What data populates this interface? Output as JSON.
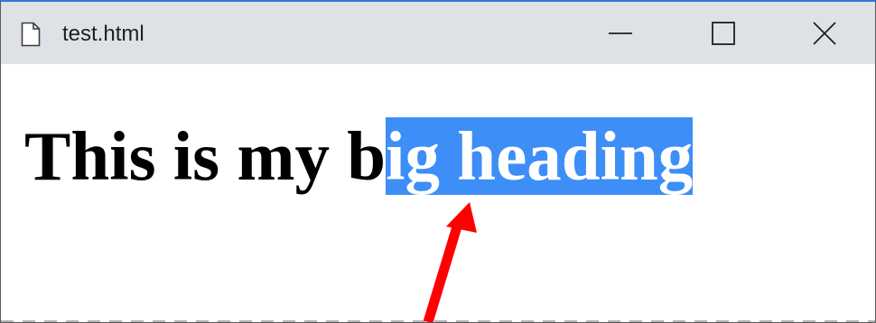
{
  "window": {
    "title": "test.html",
    "icon": "document-icon",
    "controls": {
      "minimize_icon": "minimize-icon",
      "maximize_icon": "maximize-icon",
      "close_icon": "close-icon"
    }
  },
  "content": {
    "heading_unselected": "This is my b",
    "heading_selected": "ig heading",
    "selection_color": "#3d8ef7"
  },
  "annotation": {
    "arrow_color": "#ff0000",
    "arrow_icon": "red-arrow-icon"
  }
}
